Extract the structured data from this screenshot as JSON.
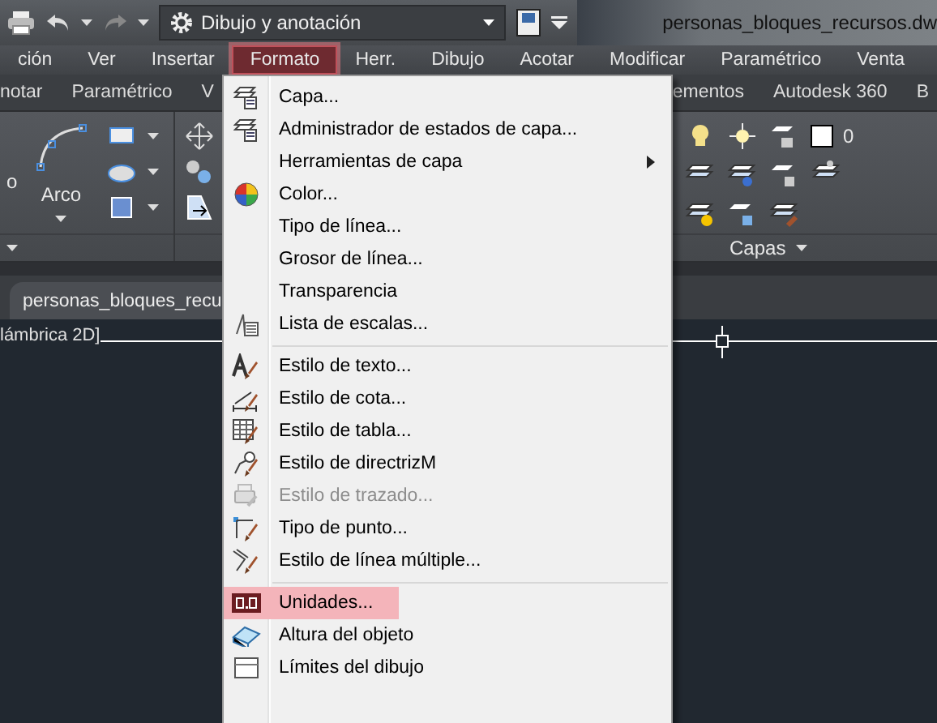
{
  "title_bar": {
    "workspace": "Dibujo y anotación",
    "file_title": "personas_bloques_recursos.dw"
  },
  "menu_bar": [
    {
      "label": "ción",
      "selected": false
    },
    {
      "label": "Ver",
      "selected": false
    },
    {
      "label": "Insertar",
      "selected": false
    },
    {
      "label": "Formato",
      "selected": true
    },
    {
      "label": "Herr.",
      "selected": false
    },
    {
      "label": "Dibujo",
      "selected": false
    },
    {
      "label": "Acotar",
      "selected": false
    },
    {
      "label": "Modificar",
      "selected": false
    },
    {
      "label": "Paramétrico",
      "selected": false
    },
    {
      "label": "Venta",
      "selected": false
    }
  ],
  "ribbon_tabs": [
    {
      "label": "notar"
    },
    {
      "label": "Paramétrico"
    },
    {
      "label": "V"
    },
    {
      "label": "ementos"
    },
    {
      "label": "Autodesk 360"
    },
    {
      "label": "B"
    }
  ],
  "ribbon": {
    "left_label": "o",
    "arc_label": "Arco",
    "layer_name": "0",
    "layers_panel": "Capas"
  },
  "file_tab": {
    "label": "personas_bloques_recu"
  },
  "viewport": {
    "label": "lámbrica 2D]"
  },
  "format_menu": [
    {
      "kind": "item",
      "label": "Capa...",
      "selected": false,
      "disabled": false,
      "has_submenu": false
    },
    {
      "kind": "item",
      "label": "Administrador de estados de capa...",
      "selected": false,
      "disabled": false,
      "has_submenu": false
    },
    {
      "kind": "item",
      "label": "Herramientas de capa",
      "selected": false,
      "disabled": false,
      "has_submenu": true
    },
    {
      "kind": "item",
      "label": "Color...",
      "selected": false,
      "disabled": false,
      "has_submenu": false
    },
    {
      "kind": "item",
      "label": "Tipo de línea...",
      "selected": false,
      "disabled": false,
      "has_submenu": false
    },
    {
      "kind": "item",
      "label": "Grosor de línea...",
      "selected": false,
      "disabled": false,
      "has_submenu": false
    },
    {
      "kind": "item",
      "label": "Transparencia",
      "selected": false,
      "disabled": false,
      "has_submenu": false
    },
    {
      "kind": "item",
      "label": "Lista de escalas...",
      "selected": false,
      "disabled": false,
      "has_submenu": false
    },
    {
      "kind": "separator"
    },
    {
      "kind": "item",
      "label": "Estilo de texto...",
      "selected": false,
      "disabled": false,
      "has_submenu": false
    },
    {
      "kind": "item",
      "label": "Estilo de cota...",
      "selected": false,
      "disabled": false,
      "has_submenu": false
    },
    {
      "kind": "item",
      "label": "Estilo de tabla...",
      "selected": false,
      "disabled": false,
      "has_submenu": false
    },
    {
      "kind": "item",
      "label": "Estilo de directrizM",
      "selected": false,
      "disabled": false,
      "has_submenu": false
    },
    {
      "kind": "item",
      "label": "Estilo de trazado...",
      "selected": false,
      "disabled": true,
      "has_submenu": false
    },
    {
      "kind": "item",
      "label": "Tipo de punto...",
      "selected": false,
      "disabled": false,
      "has_submenu": false
    },
    {
      "kind": "item",
      "label": "Estilo de línea múltiple...",
      "selected": false,
      "disabled": false,
      "has_submenu": false
    },
    {
      "kind": "separator"
    },
    {
      "kind": "item",
      "label": "Unidades...",
      "selected": true,
      "disabled": false,
      "has_submenu": false
    },
    {
      "kind": "item",
      "label": "Altura del objeto",
      "selected": false,
      "disabled": false,
      "has_submenu": false
    },
    {
      "kind": "item",
      "label": "Límites del dibujo",
      "selected": false,
      "disabled": false,
      "has_submenu": false
    }
  ]
}
